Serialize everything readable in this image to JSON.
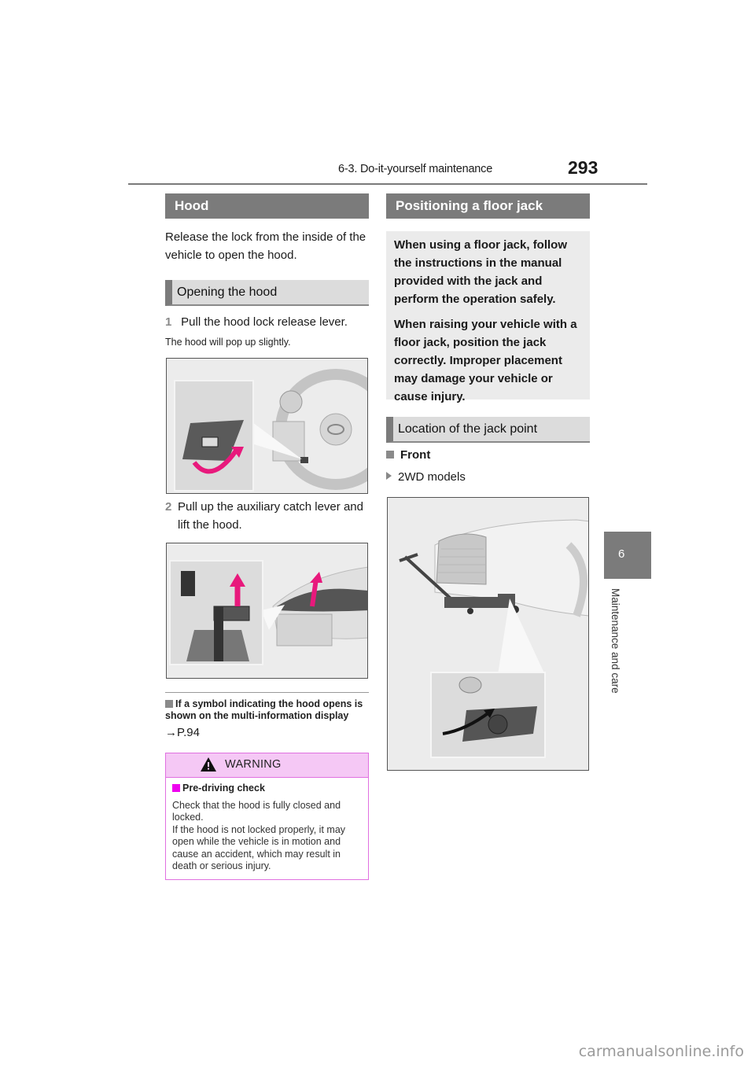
{
  "header": {
    "section": "6-3. Do-it-yourself maintenance",
    "page_number": "293"
  },
  "side_tab": {
    "chapter_number": "6",
    "chapter_label": "Maintenance and care"
  },
  "left_column": {
    "hood_header": "Hood",
    "intro": "Release the lock from the inside of the vehicle to open the hood.",
    "opening_header": "Opening the hood",
    "steps": [
      {
        "number": "1",
        "text": "Pull the hood lock release lever.",
        "note": "The hood will pop up slightly."
      },
      {
        "number": "2",
        "text": "Pull up the auxiliary catch lever and lift the hood."
      }
    ],
    "figure1_icon": "hood-release-lever-illustration",
    "figure2_icon": "auxiliary-catch-lever-illustration",
    "note_heading": "If a symbol indicating the hood opens is shown on the multi-information display",
    "note_ref": "→P.94",
    "warning": {
      "title": "WARNING",
      "subheading": "Pre-driving check",
      "lines": [
        "Check that the hood is fully closed and locked.",
        "If the hood is not locked properly, it may open while the vehicle is in motion and cause an accident, which may result in death or serious injury."
      ]
    }
  },
  "right_column": {
    "jack_header": "Positioning a floor jack",
    "info_paragraphs": [
      "When using a floor jack, follow the instructions in the manual provided with the jack and perform the operation safely.",
      "When raising your vehicle with a floor jack, position the jack correctly. Improper placement may damage your vehicle or cause injury."
    ],
    "location_header": "Location of the jack point",
    "bullet_front": "Front",
    "sub_2wd": "2WD models",
    "figure3_icon": "floor-jack-point-illustration"
  },
  "colors": {
    "header_gray": "#7b7b7b",
    "warning_magenta": "#ee00ee",
    "warning_bg": "#f5c8f5",
    "arrow_pink": "#e8197c"
  },
  "watermark": "carmanualsonline.info"
}
